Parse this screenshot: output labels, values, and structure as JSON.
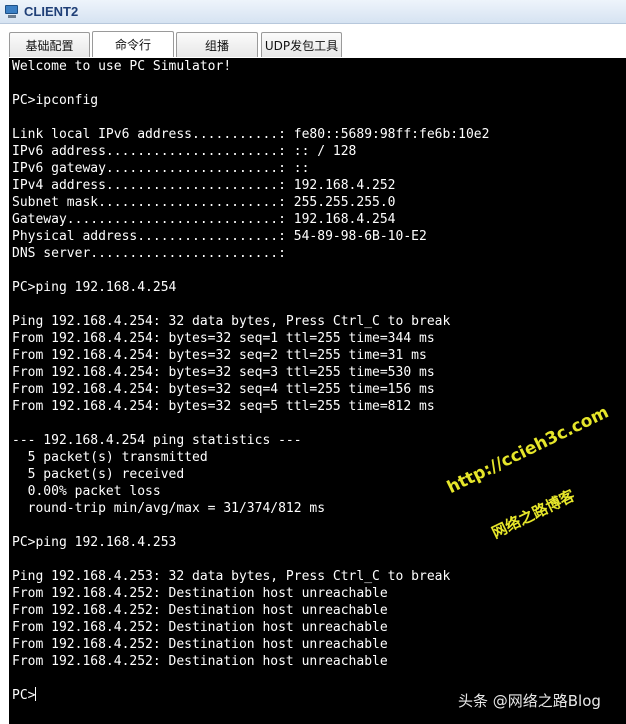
{
  "window": {
    "title": "CLIENT2"
  },
  "tabs": [
    {
      "label": "基础配置"
    },
    {
      "label": "命令行"
    },
    {
      "label": "组播"
    },
    {
      "label": "UDP发包工具"
    }
  ],
  "terminal": {
    "lines": [
      "Welcome to use PC Simulator!",
      "",
      "PC>ipconfig",
      "",
      "Link local IPv6 address...........: fe80::5689:98ff:fe6b:10e2",
      "IPv6 address......................: :: / 128",
      "IPv6 gateway......................: ::",
      "IPv4 address......................: 192.168.4.252",
      "Subnet mask.......................: 255.255.255.0",
      "Gateway...........................: 192.168.4.254",
      "Physical address..................: 54-89-98-6B-10-E2",
      "DNS server........................:",
      "",
      "PC>ping 192.168.4.254",
      "",
      "Ping 192.168.4.254: 32 data bytes, Press Ctrl_C to break",
      "From 192.168.4.254: bytes=32 seq=1 ttl=255 time=344 ms",
      "From 192.168.4.254: bytes=32 seq=2 ttl=255 time=31 ms",
      "From 192.168.4.254: bytes=32 seq=3 ttl=255 time=530 ms",
      "From 192.168.4.254: bytes=32 seq=4 ttl=255 time=156 ms",
      "From 192.168.4.254: bytes=32 seq=5 ttl=255 time=812 ms",
      "",
      "--- 192.168.4.254 ping statistics ---",
      "  5 packet(s) transmitted",
      "  5 packet(s) received",
      "  0.00% packet loss",
      "  round-trip min/avg/max = 31/374/812 ms",
      "",
      "PC>ping 192.168.4.253",
      "",
      "Ping 192.168.4.253: 32 data bytes, Press Ctrl_C to break",
      "From 192.168.4.252: Destination host unreachable",
      "From 192.168.4.252: Destination host unreachable",
      "From 192.168.4.252: Destination host unreachable",
      "From 192.168.4.252: Destination host unreachable",
      "From 192.168.4.252: Destination host unreachable",
      "",
      "PC>"
    ]
  },
  "watermarks": {
    "url": "http://ccieh3c.com",
    "blog_name": "网络之路博客",
    "footer": "头条 @网络之路Blog"
  },
  "colors": {
    "terminal_bg": "#000000",
    "terminal_fg": "#ffffff",
    "title_text": "#1f3f77",
    "watermark": "#e6e62a"
  }
}
